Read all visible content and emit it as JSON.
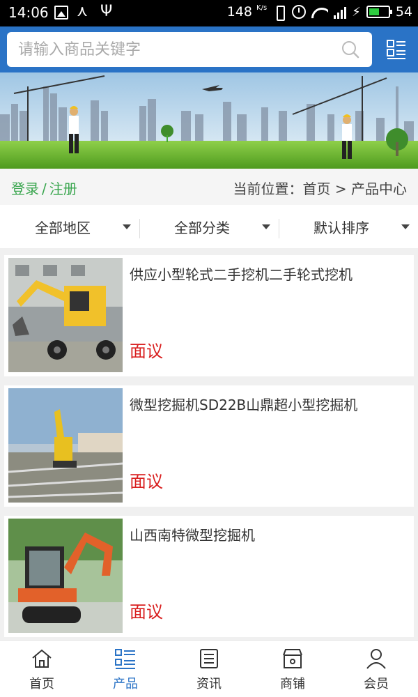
{
  "status_bar": {
    "time": "14:06",
    "net_speed": "148",
    "net_unit": "K/s",
    "battery": "54"
  },
  "search": {
    "placeholder": "请输入商品关键字"
  },
  "info_bar": {
    "login": "登录",
    "separator": "/",
    "register": "注册",
    "location": "当前位置：首页 > 产品中心"
  },
  "filters": [
    {
      "label": "全部地区"
    },
    {
      "label": "全部分类"
    },
    {
      "label": "默认排序"
    }
  ],
  "products": [
    {
      "title": "供应小型轮式二手挖机二手轮式挖机",
      "price": "面议"
    },
    {
      "title": "微型挖掘机SD22B山鼎超小型挖掘机",
      "price": "面议"
    },
    {
      "title": "山西南特微型挖掘机",
      "price": "面议"
    }
  ],
  "bottom_nav": [
    {
      "label": "首页",
      "icon": "home-icon"
    },
    {
      "label": "产品",
      "icon": "list-icon",
      "active": true
    },
    {
      "label": "资讯",
      "icon": "news-icon"
    },
    {
      "label": "商铺",
      "icon": "store-icon"
    },
    {
      "label": "会员",
      "icon": "user-icon"
    }
  ],
  "colors": {
    "header": "#2a73c6",
    "accent": "#3aa64f",
    "price": "#d92020"
  }
}
